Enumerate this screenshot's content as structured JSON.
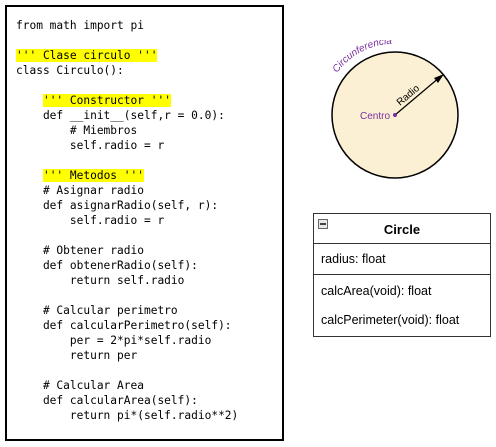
{
  "code": {
    "lines": [
      "from math import pi",
      "",
      "''' Clase circulo '''",
      "class Circulo():",
      "",
      "    ''' Constructor '''",
      "    def __init__(self,r = 0.0):",
      "        # Miembros",
      "        self.radio = r",
      "",
      "    ''' Metodos '''",
      "    # Asignar radio",
      "    def asignarRadio(self, r):",
      "        self.radio = r",
      "",
      "    # Obtener radio",
      "    def obtenerRadio(self):",
      "        return self.radio",
      "",
      "    # Calcular perimetro",
      "    def calcularPerimetro(self):",
      "        per = 2*pi*self.radio",
      "        return per",
      "",
      "    # Calcular Area",
      "    def calcularArea(self):",
      "        return pi*(self.radio**2)"
    ],
    "highlighted_lines": [
      2,
      5,
      10
    ],
    "highlight_color": "#ffff00"
  },
  "diagram": {
    "circumference_label": "Circunferencia",
    "radius_label": "Radio",
    "center_label": "Centro",
    "circle_fill": "#fcf0d4",
    "label_color": "#7a2f9e"
  },
  "uml": {
    "class_name": "Circle",
    "attributes": [
      "radius: float"
    ],
    "methods": [
      "calcArea(void): float",
      "calcPerimeter(void): float"
    ]
  }
}
